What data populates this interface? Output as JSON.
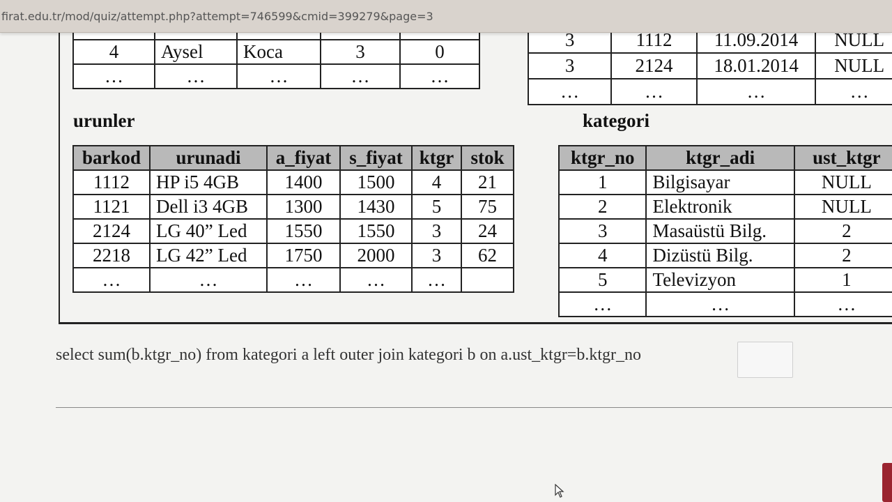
{
  "browser": {
    "url": "firat.edu.tr/mod/quiz/attempt.php?attempt=746599&cmid=399279&page=3"
  },
  "top_left_table": {
    "rows": [
      [
        "4",
        "Aysel",
        "Koca",
        "3",
        "0"
      ],
      [
        "…",
        "…",
        "…",
        "…",
        "…"
      ]
    ]
  },
  "top_right_table": {
    "rows": [
      [
        "3",
        "1112",
        "11.09.2014",
        "NULL"
      ],
      [
        "3",
        "2124",
        "18.01.2014",
        "NULL"
      ],
      [
        "…",
        "…",
        "…",
        "…"
      ]
    ]
  },
  "urunler": {
    "title": "urunler",
    "headers": [
      "barkod",
      "urunadi",
      "a_fiyat",
      "s_fiyat",
      "ktgr",
      "stok"
    ],
    "rows": [
      [
        "1112",
        "HP i5 4GB",
        "1400",
        "1500",
        "4",
        "21"
      ],
      [
        "1121",
        "Dell i3 4GB",
        "1300",
        "1430",
        "5",
        "75"
      ],
      [
        "2124",
        "LG 40” Led",
        "1550",
        "1550",
        "3",
        "24"
      ],
      [
        "2218",
        "LG 42” Led",
        "1750",
        "2000",
        "3",
        "62"
      ],
      [
        "…",
        "…",
        "…",
        "…",
        "…",
        ""
      ]
    ]
  },
  "kategori": {
    "title": "kategori",
    "headers": [
      "ktgr_no",
      "ktgr_adi",
      "ust_ktgr"
    ],
    "rows": [
      [
        "1",
        "Bilgisayar",
        "NULL"
      ],
      [
        "2",
        "Elektronik",
        "NULL"
      ],
      [
        "3",
        "Masaüstü Bilg.",
        "2"
      ],
      [
        "4",
        "Dizüstü Bilg.",
        "2"
      ],
      [
        "5",
        "Televizyon",
        "1"
      ],
      [
        "…",
        "…",
        "…"
      ]
    ]
  },
  "question": {
    "text": "select sum(b.ktgr_no) from kategori a left outer join kategori b on a.ust_ktgr=b.ktgr_no",
    "answer_value": ""
  }
}
